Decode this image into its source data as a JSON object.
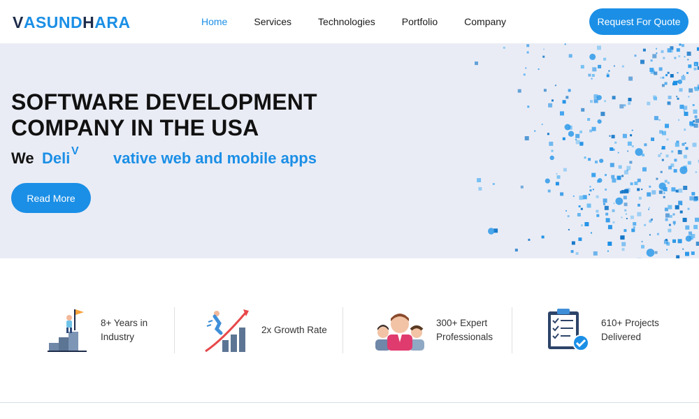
{
  "header": {
    "logo": {
      "part1": "V",
      "part2": "ASUND",
      "part3": "H",
      "part4": "ARA"
    },
    "nav": [
      "Home",
      "Services",
      "Technologies",
      "Portfolio",
      "Company"
    ],
    "active_nav": "Home",
    "quote_label": "Request For Quote"
  },
  "hero": {
    "title_line1": "SOFTWARE DEVELOPMENT",
    "title_line2": "COMPANY IN THE USA",
    "sub_we": "We",
    "sub_typed": "Deli",
    "sub_cursor": "V",
    "sub_rest": "vative web and mobile apps",
    "read_more_label": "Read More"
  },
  "stats": [
    {
      "line1": "8+ Years in",
      "line2": "Industry",
      "icon": "years-icon"
    },
    {
      "line1": "2x Growth Rate",
      "line2": "",
      "icon": "growth-icon"
    },
    {
      "line1": "300+ Expert",
      "line2": "Professionals",
      "icon": "team-icon"
    },
    {
      "line1": "610+ Projects",
      "line2": "Delivered",
      "icon": "projects-icon"
    }
  ],
  "colors": {
    "accent": "#1b8fe6",
    "hero_bg": "#eaecf5",
    "dark": "#1d2c4a"
  }
}
